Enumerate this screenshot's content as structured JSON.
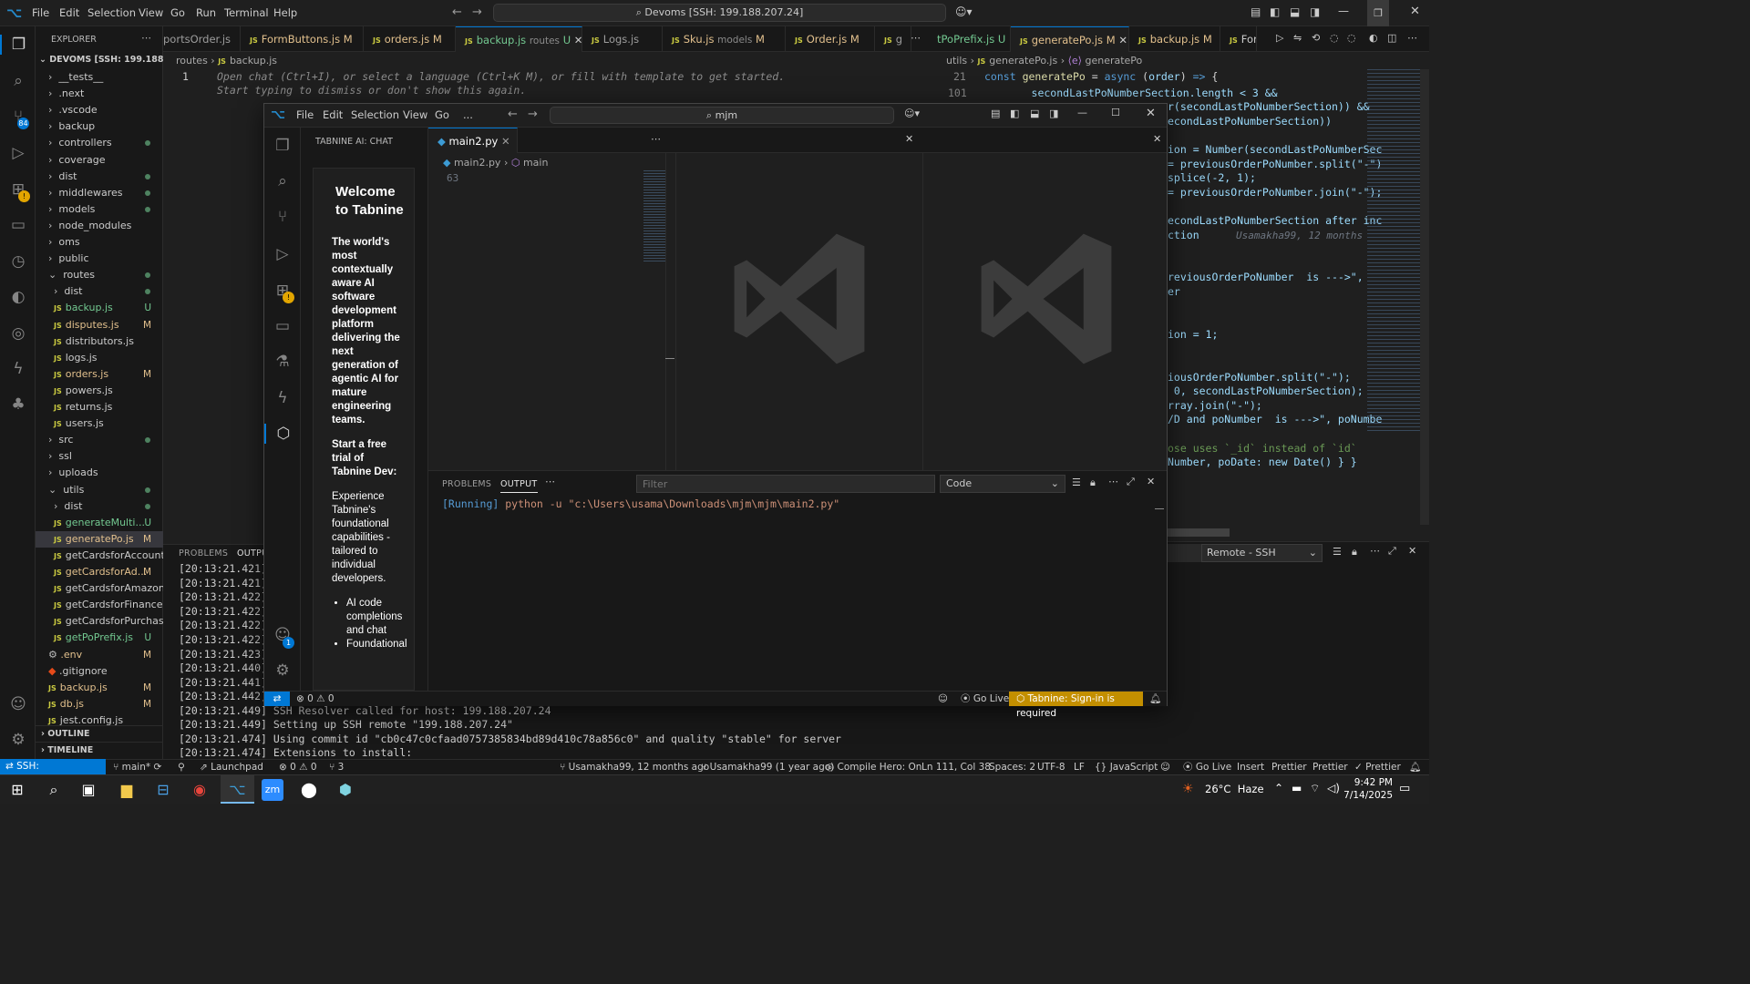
{
  "back": {
    "menu": [
      "File",
      "Edit",
      "Selection",
      "View",
      "Go",
      "Run",
      "Terminal",
      "Help"
    ],
    "command_center": "Devoms [SSH: 199.188.207.24]",
    "explorer_title": "EXPLORER",
    "root": "DEVOMS [SSH: 199.188.20...",
    "tree": [
      {
        "label": "__tests__",
        "type": "folder",
        "depth": 0,
        "dot": false,
        "status": ""
      },
      {
        "label": ".next",
        "type": "folder",
        "depth": 0,
        "dot": false,
        "status": ""
      },
      {
        "label": ".vscode",
        "type": "folder",
        "depth": 0,
        "dot": false,
        "status": ""
      },
      {
        "label": "backup",
        "type": "folder",
        "depth": 0,
        "dot": false,
        "status": ""
      },
      {
        "label": "controllers",
        "type": "folder",
        "depth": 0,
        "dot": true,
        "status": ""
      },
      {
        "label": "coverage",
        "type": "folder",
        "depth": 0,
        "dot": false,
        "status": ""
      },
      {
        "label": "dist",
        "type": "folder",
        "depth": 0,
        "dot": true,
        "status": ""
      },
      {
        "label": "middlewares",
        "type": "folder",
        "depth": 0,
        "dot": true,
        "status": ""
      },
      {
        "label": "models",
        "type": "folder",
        "depth": 0,
        "dot": true,
        "status": ""
      },
      {
        "label": "node_modules",
        "type": "folder",
        "depth": 0,
        "dot": false,
        "status": ""
      },
      {
        "label": "oms",
        "type": "folder",
        "depth": 0,
        "dot": false,
        "status": ""
      },
      {
        "label": "public",
        "type": "folder",
        "depth": 0,
        "dot": false,
        "status": ""
      },
      {
        "label": "routes",
        "type": "folder-open",
        "depth": 0,
        "dot": true,
        "status": ""
      },
      {
        "label": "dist",
        "type": "folder",
        "depth": 1,
        "dot": true,
        "status": ""
      },
      {
        "label": "backup.js",
        "type": "js",
        "depth": 1,
        "dot": false,
        "status": "U"
      },
      {
        "label": "disputes.js",
        "type": "js",
        "depth": 1,
        "dot": false,
        "status": "M"
      },
      {
        "label": "distributors.js",
        "type": "js",
        "depth": 1,
        "dot": false,
        "status": ""
      },
      {
        "label": "logs.js",
        "type": "js",
        "depth": 1,
        "dot": false,
        "status": ""
      },
      {
        "label": "orders.js",
        "type": "js",
        "depth": 1,
        "dot": false,
        "status": "M"
      },
      {
        "label": "powers.js",
        "type": "js",
        "depth": 1,
        "dot": false,
        "status": ""
      },
      {
        "label": "returns.js",
        "type": "js",
        "depth": 1,
        "dot": false,
        "status": ""
      },
      {
        "label": "users.js",
        "type": "js",
        "depth": 1,
        "dot": false,
        "status": ""
      },
      {
        "label": "src",
        "type": "folder",
        "depth": 0,
        "dot": true,
        "status": ""
      },
      {
        "label": "ssl",
        "type": "folder",
        "depth": 0,
        "dot": false,
        "status": ""
      },
      {
        "label": "uploads",
        "type": "folder",
        "depth": 0,
        "dot": false,
        "status": ""
      },
      {
        "label": "utils",
        "type": "folder-open",
        "depth": 0,
        "dot": true,
        "status": ""
      },
      {
        "label": "dist",
        "type": "folder",
        "depth": 1,
        "dot": true,
        "status": ""
      },
      {
        "label": "generateMulti...",
        "type": "js",
        "depth": 1,
        "dot": false,
        "status": "U"
      },
      {
        "label": "generatePo.js",
        "type": "js",
        "depth": 1,
        "dot": false,
        "status": "M",
        "selected": true
      },
      {
        "label": "getCardsforAccount.js",
        "type": "js",
        "depth": 1,
        "dot": false,
        "status": ""
      },
      {
        "label": "getCardsforAd...",
        "type": "js",
        "depth": 1,
        "dot": false,
        "status": "M"
      },
      {
        "label": "getCardsforAmazon.js",
        "type": "js",
        "depth": 1,
        "dot": false,
        "status": ""
      },
      {
        "label": "getCardsforFinance.js",
        "type": "js",
        "depth": 1,
        "dot": false,
        "status": ""
      },
      {
        "label": "getCardsforPurchasi...",
        "type": "js",
        "depth": 1,
        "dot": false,
        "status": ""
      },
      {
        "label": "getPoPrefix.js",
        "type": "js",
        "depth": 1,
        "dot": false,
        "status": "U"
      },
      {
        "label": ".env",
        "type": "gear",
        "depth": 0,
        "dot": false,
        "status": "M"
      },
      {
        "label": ".gitignore",
        "type": "git",
        "depth": 0,
        "dot": false,
        "status": ""
      },
      {
        "label": "backup.js",
        "type": "js",
        "depth": 0,
        "dot": false,
        "status": "M"
      },
      {
        "label": "db.js",
        "type": "js",
        "depth": 0,
        "dot": false,
        "status": "M"
      },
      {
        "label": "jest.config.js",
        "type": "js",
        "depth": 0,
        "dot": false,
        "status": ""
      }
    ],
    "outline": "OUTLINE",
    "timeline": "TIMELINE",
    "tabs": [
      {
        "label": "portsOrder.js",
        "status": ""
      },
      {
        "label": "FormButtons.js",
        "status": "M"
      },
      {
        "label": "orders.js",
        "status": "M"
      },
      {
        "label": "backup.js",
        "desc": "routes",
        "status": "U",
        "active": true
      },
      {
        "label": "Logs.js",
        "status": ""
      },
      {
        "label": "Sku.js",
        "desc": "models",
        "status": "M"
      },
      {
        "label": "Order.js",
        "status": "M"
      },
      {
        "label": "g",
        "status": ""
      }
    ],
    "tabs_right": [
      {
        "label": "tPoPrefix.js",
        "status": "U"
      },
      {
        "label": "generatePo.js",
        "status": "M",
        "active": true
      },
      {
        "label": "backup.js",
        "status": "M"
      },
      {
        "label": "For",
        "status": ""
      }
    ],
    "crumb_left": [
      "routes",
      "backup.js"
    ],
    "crumb_right": [
      "utils",
      "generatePo.js",
      "generatePo"
    ],
    "editor_line_no": "1",
    "hint_line1": "Open chat (Ctrl+I), or select a language (Ctrl+K M), or fill with template to get started.",
    "hint_line2": "Start typing to dismiss or don't show this again.",
    "right_line_nos": [
      "21",
      "101"
    ],
    "right_code": [
      "const generatePo = async (order) => {",
      "      secondLastPoNumberSection.length < 3 &&",
      "r(secondLastPoNumberSection)) &&",
      "econdLastPoNumberSection))",
      "",
      "ion = Number(secondLastPoNumberSec",
      "= previousOrderPoNumber.split(\"-\")",
      "splice(-2, 1);",
      "= previousOrderPoNumber.join(\"-\");",
      "",
      "econdLastPoNumberSection after inc",
      "ction",
      "",
      "",
      "reviousOrderPoNumber  is --->\",",
      "er",
      "",
      "",
      "ion = 1;",
      "",
      "",
      "iousOrderPoNumber.split(\"-\");",
      " 0, secondLastPoNumberSection);",
      "rray.join(\"-\");",
      "/D and poNumber  is --->\", poNumbe",
      "",
      "ose uses `_id` instead of `id`",
      "Number, poDate: new Date() } }"
    ],
    "blame": "Usamakha99, 12 months",
    "bpanel_tabs": [
      "PROBLEMS",
      "OUTPU"
    ],
    "term_lines": [
      "[20:13:21.421]",
      "[20:13:21.421]",
      "[20:13:21.422]",
      "[20:13:21.422]",
      "[20:13:21.422]",
      "[20:13:21.422]",
      "[20:13:21.423]",
      "[20:13:21.440]",
      "[20:13:21.441]",
      "[20:13:21.442]"
    ],
    "term_full": [
      "[20:13:21.449] SSH Resolver called for host: 199.188.207.24",
      "[20:13:21.449] Setting up SSH remote \"199.188.207.24\"",
      "[20:13:21.474] Using commit id \"cb0c47c0cfaad0757385834bd89d410c78a856c0\" and quality \"stable\" for server",
      "[20:13:21.474] Extensions to install:"
    ],
    "right_panel_select": "Remote - SSH",
    "status": {
      "remote": "SSH: 199.188.207.24",
      "branch": "main*",
      "launchpad": "Launchpad",
      "errors": "0",
      "warnings": "0",
      "ports": "3",
      "blame1": "Usamakha99, 12 months ago",
      "blame2": "Usamakha99 (1 year ago)",
      "compile": "Compile Hero: On",
      "pos": "Ln 111, Col 38",
      "spaces": "Spaces: 2",
      "enc": "UTF-8",
      "eol": "LF",
      "lang": "JavaScript",
      "golive": "Go Live",
      "insert": "Insert",
      "prettier1": "Prettier",
      "prettier2": "Prettier",
      "prettier3": "Prettier"
    }
  },
  "front": {
    "menu": [
      "File",
      "Edit",
      "Selection",
      "View",
      "Go",
      "..."
    ],
    "search": "mjm",
    "panel_title": "TABNINE AI: CHAT",
    "welcome_title": "Welcome to Tabnine",
    "welcome_lead": "The world's most contextually aware AI software development platform delivering the next generation of agentic AI for mature engineering teams.",
    "welcome_trial": "Start a free trial of Tabnine Dev:",
    "welcome_body": "Experience Tabnine's foundational capabilities - tailored to individual developers.",
    "welcome_bullets": [
      "AI code completions and chat",
      "Foundational"
    ],
    "tab_label": "main2.py",
    "crumb": [
      "main2.py",
      "main"
    ],
    "line_no": "63",
    "panel_tabs": [
      "PROBLEMS",
      "OUTPUT"
    ],
    "filter_placeholder": "Filter",
    "output_select": "Code",
    "output_line": "[Running] python -u \"c:\\Users\\usama\\Downloads\\mjm\\mjm\\main2.py\"",
    "status_errors": "0",
    "status_warnings": "0",
    "status_golive": "Go Live",
    "status_tabnine": "Tabnine: Sign-in is required",
    "account_badge": "1"
  },
  "taskbar": {
    "weather": "26°C  Haze",
    "time": "9:42 PM",
    "date": "7/14/2025"
  },
  "colors": {
    "accent": "#0078d4",
    "modified": "#e2c08d",
    "untracked": "#73c991",
    "tabnine": "#c38f00"
  }
}
